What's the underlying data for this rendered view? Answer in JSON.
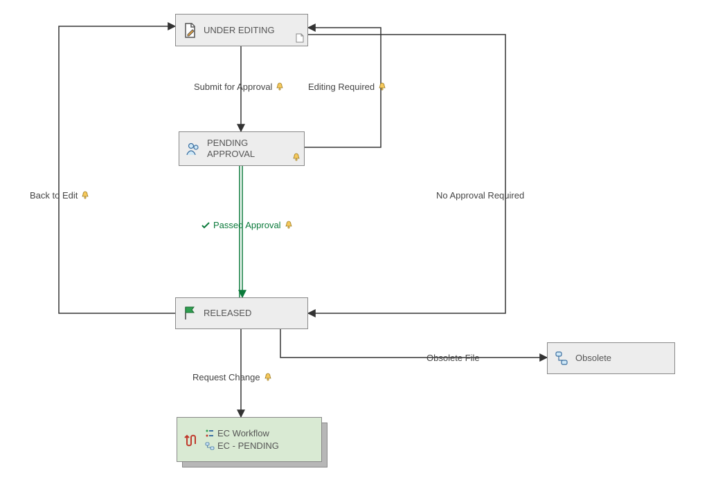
{
  "nodes": {
    "under_editing": {
      "label": "UNDER EDITING"
    },
    "pending_approval": {
      "label": "PENDING\nAPPROVAL"
    },
    "released": {
      "label": "RELEASED"
    },
    "obsolete": {
      "label": "Obsolete"
    },
    "ec": {
      "line1": "EC Workflow",
      "line2": "EC - PENDING"
    }
  },
  "edges": {
    "submit_for_approval": {
      "label": "Submit for Approval"
    },
    "editing_required": {
      "label": "Editing Required"
    },
    "no_approval_required": {
      "label": "No Approval Required"
    },
    "back_to_edit": {
      "label": "Back to Edit"
    },
    "passed_approval": {
      "label": "Passed Approval"
    },
    "request_change": {
      "label": "Request Change"
    },
    "obsolete_file": {
      "label": "Obsolete File"
    }
  },
  "icons": {
    "edit_doc": "edit-document-icon",
    "people": "people-icon",
    "flag": "flag-icon",
    "workflow": "workflow-icon",
    "bullets": "list-icon",
    "loop": "loop-icon",
    "bell": "bell-icon",
    "check": "check-icon",
    "doc_corner": "document-corner-icon"
  }
}
